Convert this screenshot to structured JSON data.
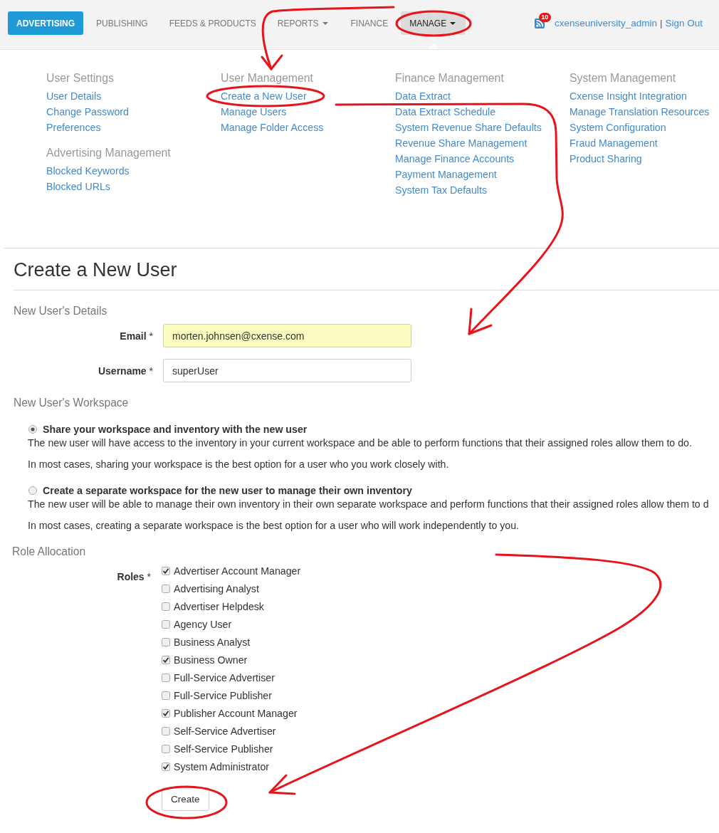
{
  "nav": {
    "items": [
      {
        "label": "ADVERTISING",
        "selected": true,
        "open": false,
        "dropdown": false
      },
      {
        "label": "PUBLISHING",
        "selected": false,
        "open": false,
        "dropdown": false
      },
      {
        "label": "FEEDS & PRODUCTS",
        "selected": false,
        "open": false,
        "dropdown": false
      },
      {
        "label": "REPORTS",
        "selected": false,
        "open": false,
        "dropdown": true
      },
      {
        "label": "FINANCE",
        "selected": false,
        "open": false,
        "dropdown": false
      },
      {
        "label": "MANAGE",
        "selected": false,
        "open": true,
        "dropdown": true
      }
    ],
    "notifications": {
      "count": "10"
    },
    "user": "cxenseuniversity_admin",
    "separator": "|",
    "sign_out": "Sign Out"
  },
  "menu": {
    "columns": [
      {
        "groups": [
          {
            "heading": "User Settings",
            "links": [
              "User Details",
              "Change Password",
              "Preferences"
            ]
          },
          {
            "heading": "Advertising Management",
            "links": [
              "Blocked Keywords",
              "Blocked URLs"
            ]
          }
        ]
      },
      {
        "groups": [
          {
            "heading": "User Management",
            "links": [
              "Create a New User",
              "Manage Users",
              "Manage Folder Access"
            ]
          }
        ]
      },
      {
        "groups": [
          {
            "heading": "Finance Management",
            "links": [
              "Data Extract",
              "Data Extract Schedule",
              "System Revenue Share Defaults",
              "Revenue Share Management",
              "Manage Finance Accounts",
              "Payment Management",
              "System Tax Defaults"
            ]
          }
        ]
      },
      {
        "groups": [
          {
            "heading": "System Management",
            "links": [
              "Cxense Insight Integration",
              "Manage Translation Resources",
              "System Configuration",
              "Fraud Management",
              "Product Sharing"
            ]
          }
        ]
      }
    ]
  },
  "page": {
    "title": "Create a New User"
  },
  "details": {
    "heading": "New User's Details",
    "fields": [
      {
        "label": "Email",
        "required_mark": "*",
        "value": "morten.johnsen@cxense.com",
        "highlighted": true
      },
      {
        "label": "Username",
        "required_mark": "*",
        "value": "superUser",
        "highlighted": false
      }
    ]
  },
  "workspace": {
    "heading": "New User's Workspace",
    "options": [
      {
        "label": "Share your workspace and inventory with the new user",
        "selected": true,
        "paragraphs": [
          "The new user will have access to the inventory in your current workspace and be able to perform functions that their assigned roles allow them to do.",
          "In most cases, sharing your workspace is the best option for a user who you work closely with."
        ]
      },
      {
        "label": "Create a separate workspace for the new user to manage their own inventory",
        "selected": false,
        "paragraphs": [
          "The new user will be able to manage their own inventory in their own separate workspace and perform functions that their assigned roles allow them to d",
          "In most cases, creating a separate workspace is the best option for a user who will work independently to you."
        ]
      }
    ]
  },
  "roles": {
    "heading": "Role Allocation",
    "label": "Roles",
    "required_mark": "*",
    "items": [
      {
        "label": "Advertiser Account Manager",
        "checked": true
      },
      {
        "label": "Advertising Analyst",
        "checked": false
      },
      {
        "label": "Advertiser Helpdesk",
        "checked": false
      },
      {
        "label": "Agency User",
        "checked": false
      },
      {
        "label": "Business Analyst",
        "checked": false
      },
      {
        "label": "Business Owner",
        "checked": true
      },
      {
        "label": "Full-Service Advertiser",
        "checked": false
      },
      {
        "label": "Full-Service Publisher",
        "checked": false
      },
      {
        "label": "Publisher Account Manager",
        "checked": true
      },
      {
        "label": "Self-Service Advertiser",
        "checked": false
      },
      {
        "label": "Self-Service Publisher",
        "checked": false
      },
      {
        "label": "System Administrator",
        "checked": true
      }
    ]
  },
  "submit": {
    "label": "Create"
  }
}
